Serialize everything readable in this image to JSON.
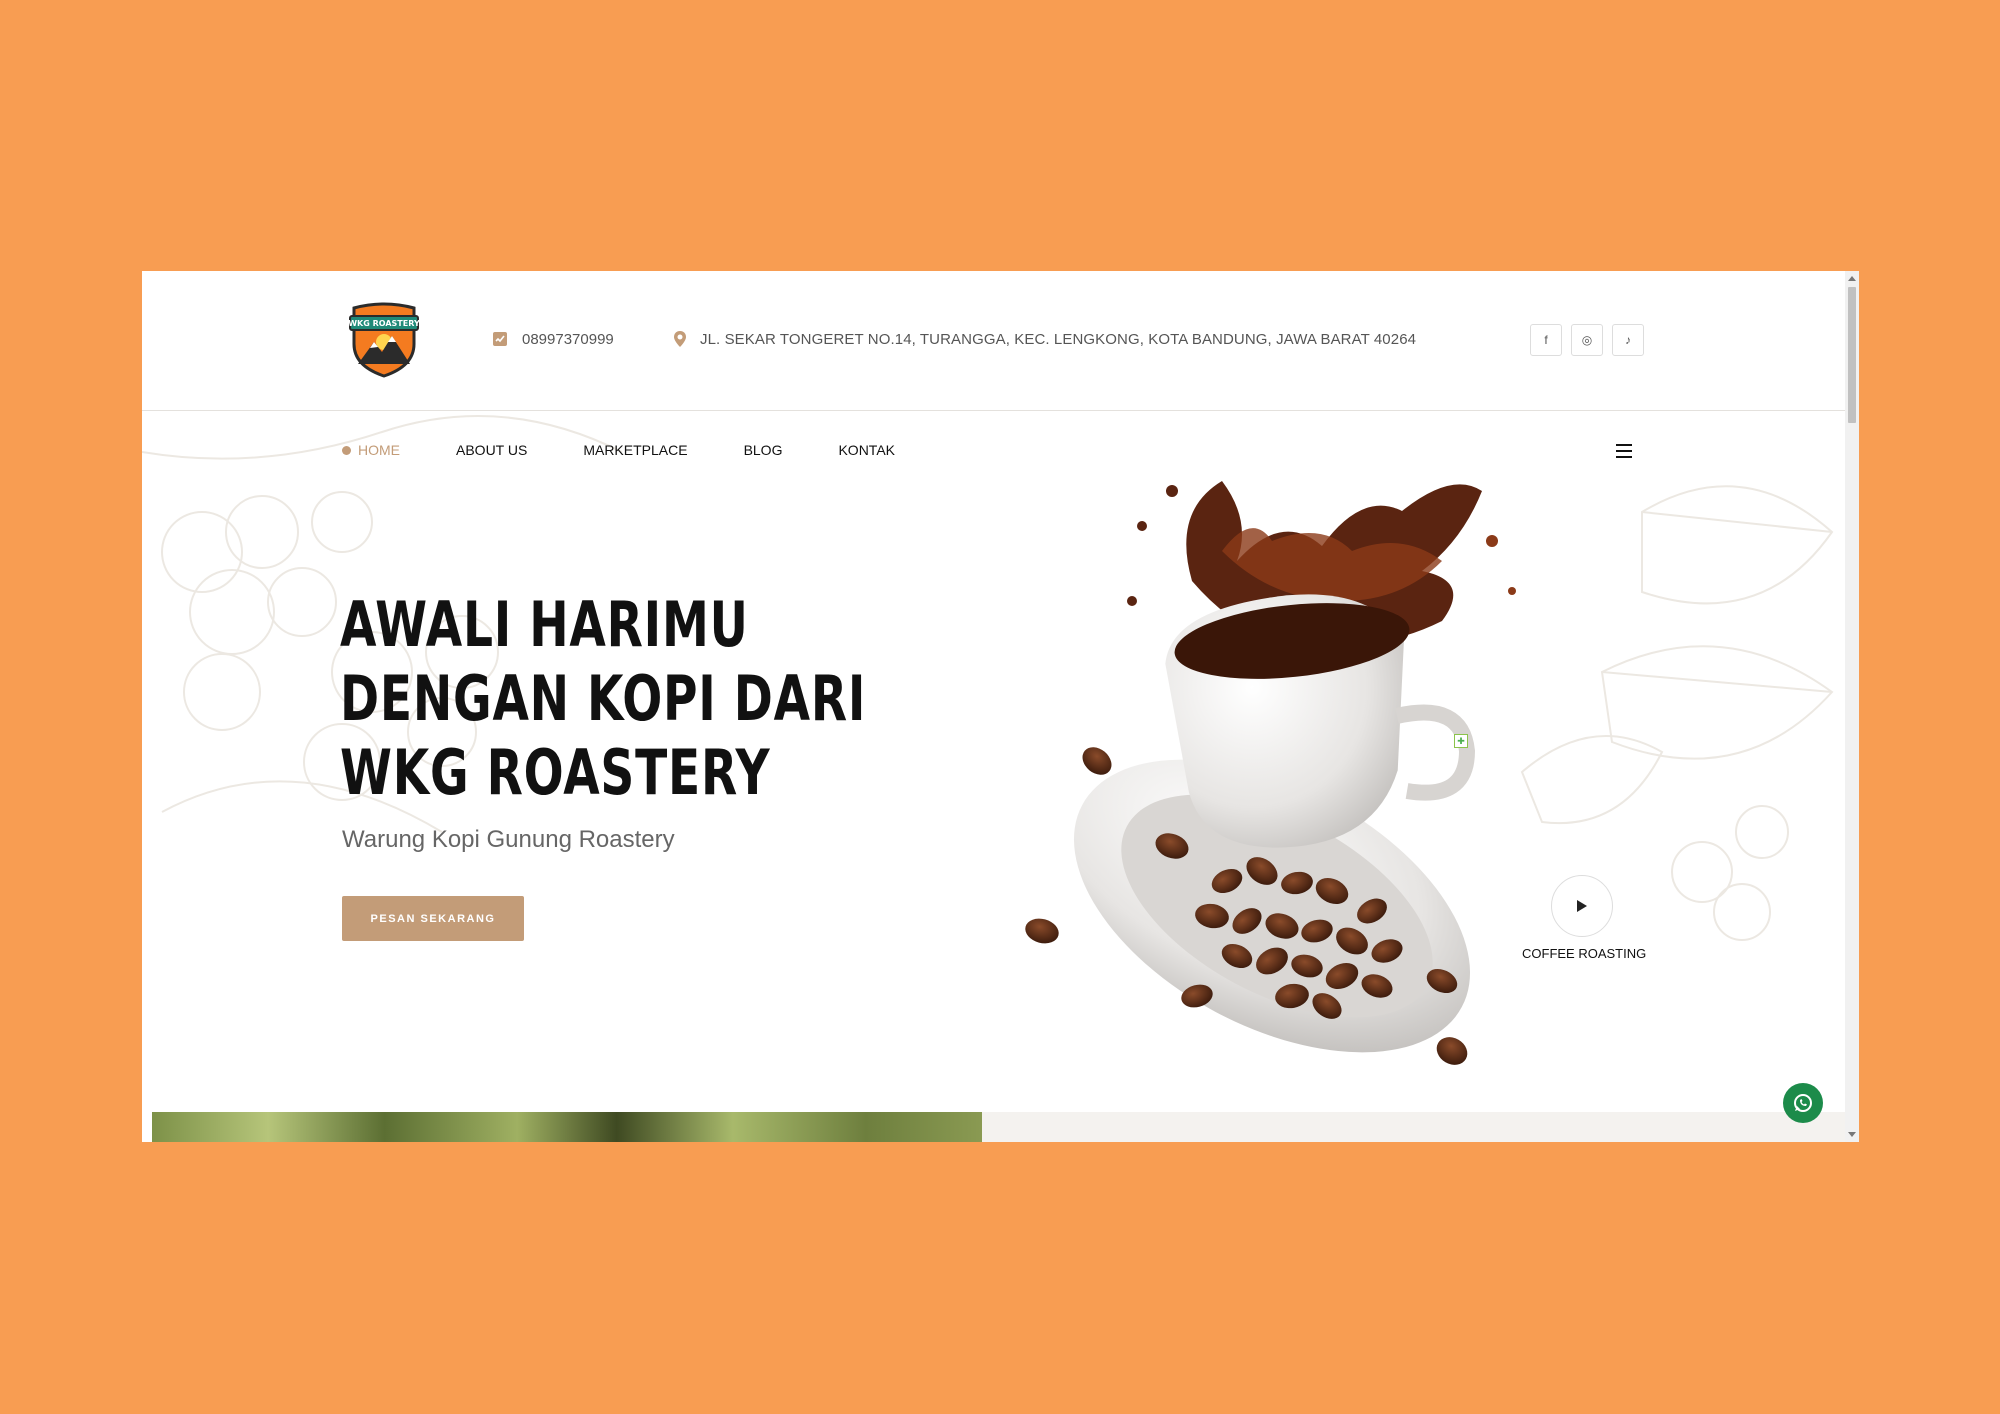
{
  "brand": {
    "logo_text": "WKG ROASTERY"
  },
  "topbar": {
    "phone": "08997370999",
    "address": "JL. SEKAR TONGERET NO.14, TURANGGA, KEC. LENGKONG, KOTA BANDUNG, JAWA BARAT 40264",
    "socials": [
      {
        "icon": "facebook-icon",
        "glyph": "f"
      },
      {
        "icon": "instagram-icon",
        "glyph": "◎"
      },
      {
        "icon": "tiktok-icon",
        "glyph": "♪"
      }
    ]
  },
  "nav": {
    "items": [
      {
        "label": "HOME",
        "active": true
      },
      {
        "label": "ABOUT US",
        "active": false
      },
      {
        "label": "MARKETPLACE",
        "active": false
      },
      {
        "label": "BLOG",
        "active": false
      },
      {
        "label": "KONTAK",
        "active": false
      }
    ]
  },
  "hero": {
    "headline_lines": [
      "AWALI HARIMU",
      "DENGAN KOPI DARI",
      "WKG ROASTERY"
    ],
    "subtitle": "Warung Kopi Gunung Roastery",
    "cta_label": "PESAN SEKARANG",
    "video_label": "COFFEE ROASTING"
  },
  "colors": {
    "page_background": "#f89d52",
    "accent": "#c39c78",
    "whatsapp": "#1c8b4a",
    "text_dark": "#111111"
  }
}
